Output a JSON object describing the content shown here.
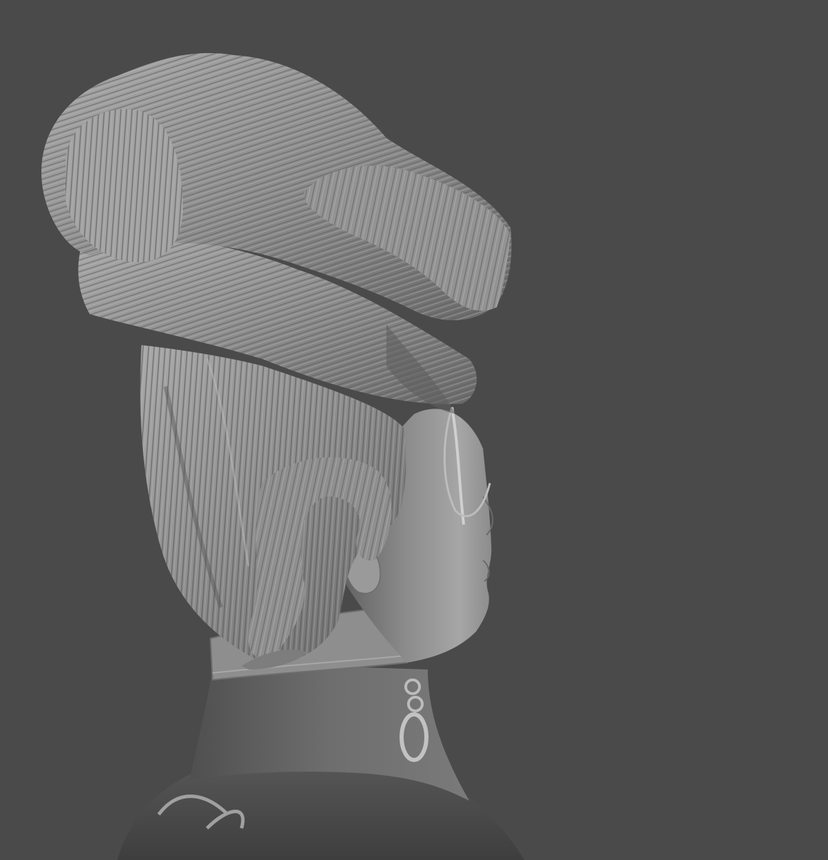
{
  "scene": {
    "subject": "clay-render-female-bust",
    "background_color": "#4a4a4a",
    "clay_light": "#b4b4b4",
    "clay_mid": "#888888",
    "clay_dark": "#5e5e5e"
  }
}
